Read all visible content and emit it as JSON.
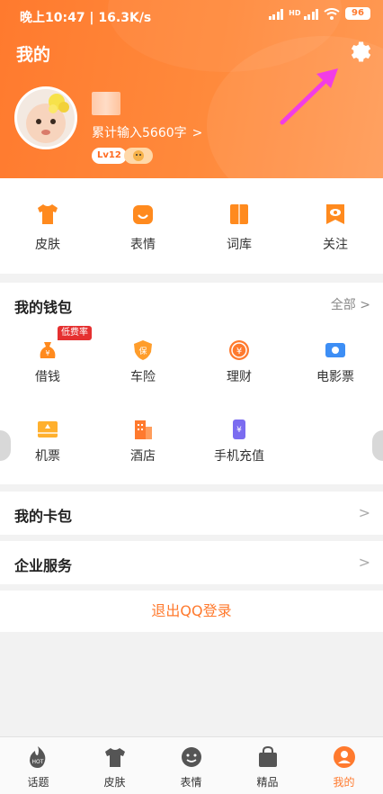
{
  "status_bar": {
    "time": "晚上10:47 | 16.3K/s",
    "battery": "96"
  },
  "header": {
    "title": "我的",
    "chars_typed": "累计输入5660字",
    "level": "Lv12"
  },
  "features": [
    {
      "label": "皮肤",
      "icon": "shirt-icon"
    },
    {
      "label": "表情",
      "icon": "smiley-icon"
    },
    {
      "label": "词库",
      "icon": "book-icon"
    },
    {
      "label": "关注",
      "icon": "eye-icon"
    }
  ],
  "wallet": {
    "title": "我的钱包",
    "all_label": "全部",
    "tag": "低费率",
    "items": [
      {
        "label": "借钱",
        "icon": "money-bag-icon"
      },
      {
        "label": "车险",
        "icon": "insurance-shield-icon"
      },
      {
        "label": "理财",
        "icon": "yuan-coin-icon"
      },
      {
        "label": "电影票",
        "icon": "movie-ticket-icon"
      },
      {
        "label": "机票",
        "icon": "plane-ticket-icon"
      },
      {
        "label": "酒店",
        "icon": "hotel-icon"
      },
      {
        "label": "手机充值",
        "icon": "phone-recharge-icon"
      }
    ]
  },
  "card_wallet": {
    "label": "我的卡包"
  },
  "enterprise": {
    "label": "企业服务"
  },
  "logout": {
    "label": "退出QQ登录"
  },
  "tabbar": [
    {
      "label": "话题",
      "icon": "hot-icon"
    },
    {
      "label": "皮肤",
      "icon": "tshirt-icon"
    },
    {
      "label": "表情",
      "icon": "face-icon"
    },
    {
      "label": "精品",
      "icon": "bag-icon"
    },
    {
      "label": "我的",
      "icon": "profile-icon",
      "active": true
    }
  ],
  "colors": {
    "accent": "#ff7a2e",
    "tag_red": "#e53030"
  }
}
